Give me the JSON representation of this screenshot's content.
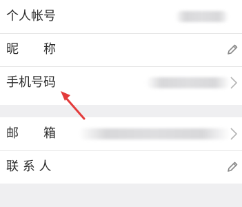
{
  "account": {
    "rows": [
      {
        "label": "个人帐号",
        "action": "none"
      },
      {
        "label": "昵　　称",
        "action": "pencil-icon"
      },
      {
        "label": "手机号码",
        "action": "chevron-right-icon"
      }
    ]
  },
  "contact": {
    "rows": [
      {
        "label": "邮　　箱",
        "action": "chevron-right-icon"
      },
      {
        "label": "联 系 人",
        "action": "pencil-icon"
      }
    ]
  },
  "colors": {
    "background": "#efeff1",
    "annotation_arrow": "#e33b3b"
  }
}
